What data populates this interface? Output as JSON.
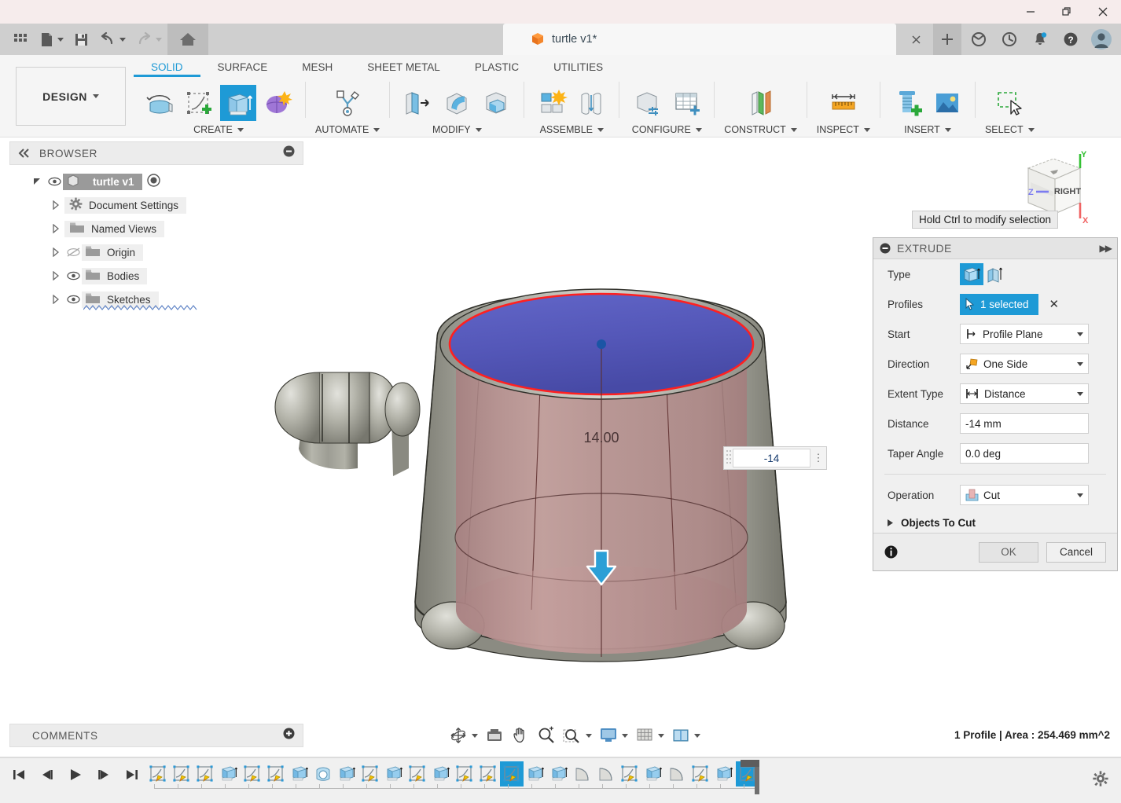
{
  "window": {
    "minimize_icon": "minimize-icon",
    "maximize_icon": "maximize-restore-icon",
    "close_icon": "close-icon"
  },
  "quick_access": {
    "items": [
      {
        "name": "app-grid-icon",
        "label": "Grid"
      },
      {
        "name": "file-icon",
        "label": "File"
      },
      {
        "name": "save-icon",
        "label": "Save"
      },
      {
        "name": "undo-icon",
        "label": "Undo"
      },
      {
        "name": "redo-icon",
        "label": "Redo"
      },
      {
        "name": "home-icon",
        "label": "Home"
      }
    ]
  },
  "document_tab": {
    "title": "turtle v1*",
    "close_label": "×",
    "new_tab_label": "+"
  },
  "tab_right_icons": [
    {
      "name": "extensions-icon"
    },
    {
      "name": "recent-icon"
    },
    {
      "name": "notifications-icon"
    },
    {
      "name": "help-icon"
    },
    {
      "name": "account-avatar"
    }
  ],
  "ribbon": {
    "design_label": "DESIGN",
    "workspace_tabs": [
      {
        "label": "SOLID",
        "active": true
      },
      {
        "label": "SURFACE",
        "active": false
      },
      {
        "label": "MESH",
        "active": false
      },
      {
        "label": "SHEET METAL",
        "active": false
      },
      {
        "label": "PLASTIC",
        "active": false
      },
      {
        "label": "UTILITIES",
        "active": false
      }
    ],
    "groups": [
      {
        "label": "CREATE",
        "icons": [
          "revolve-icon",
          "create-sketch-icon",
          "extrude-icon",
          "form-icon"
        ]
      },
      {
        "label": "AUTOMATE",
        "icons": [
          "automate-icon"
        ]
      },
      {
        "label": "MODIFY",
        "icons": [
          "press-pull-icon",
          "fillet-icon",
          "shell-icon"
        ]
      },
      {
        "label": "ASSEMBLE",
        "icons": [
          "new-component-icon",
          "joint-icon"
        ]
      },
      {
        "label": "CONFIGURE",
        "icons": [
          "configure-icon",
          "configure-table-icon"
        ]
      },
      {
        "label": "CONSTRUCT",
        "icons": [
          "offset-plane-icon"
        ]
      },
      {
        "label": "INSPECT",
        "icons": [
          "measure-icon"
        ]
      },
      {
        "label": "INSERT",
        "icons": [
          "insert-mcmaster-icon",
          "insert-canvas-icon"
        ]
      },
      {
        "label": "SELECT",
        "icons": [
          "select-icon"
        ]
      }
    ]
  },
  "browser": {
    "header": "BROWSER",
    "collapse_icon": "collapse-icon",
    "tree": [
      {
        "label": "turtle v1",
        "indent": 0,
        "expanded": true,
        "eye": "visible",
        "icon": "component-icon",
        "root": true
      },
      {
        "label": "Document Settings",
        "indent": 1,
        "expanded": false,
        "eye": "none",
        "icon": "gear-icon",
        "root": false
      },
      {
        "label": "Named Views",
        "indent": 1,
        "expanded": false,
        "eye": "none",
        "icon": "folder-icon",
        "root": false
      },
      {
        "label": "Origin",
        "indent": 1,
        "expanded": false,
        "eye": "hidden",
        "icon": "folder-icon",
        "root": false
      },
      {
        "label": "Bodies",
        "indent": 1,
        "expanded": false,
        "eye": "visible",
        "icon": "folder-icon",
        "root": false
      },
      {
        "label": "Sketches",
        "indent": 1,
        "expanded": false,
        "eye": "visible",
        "icon": "sketch-folder-icon",
        "root": false
      }
    ]
  },
  "canvas": {
    "dimension_label": "14.00",
    "tooltip": "Hold Ctrl to modify selection",
    "mini_input_value": "-14",
    "viewcube_faces": {
      "front": "RIGHT"
    },
    "axis_labels": {
      "x": "X",
      "y": "Y",
      "z": "Z"
    },
    "colors": {
      "profile_face": "#5457b8",
      "preview_cut": "#b98b8b",
      "highlight_edge": "#ff2020",
      "body": "#9a9a92",
      "arrow": "#2c9fd6"
    }
  },
  "extrude_dialog": {
    "title": "EXTRUDE",
    "collapse_icon": "collapse-icon",
    "expand_icon": "expand-icon",
    "rows": {
      "type_label": "Type",
      "type_options": [
        "solid-extrude-icon",
        "thin-extrude-icon"
      ],
      "profiles_label": "Profiles",
      "profiles_value": "1 selected",
      "profiles_clear": "✕",
      "start_label": "Start",
      "start_value": "Profile Plane",
      "direction_label": "Direction",
      "direction_value": "One Side",
      "extent_label": "Extent Type",
      "extent_value": "Distance",
      "distance_label": "Distance",
      "distance_value": "-14 mm",
      "taper_label": "Taper Angle",
      "taper_value": "0.0 deg",
      "operation_label": "Operation",
      "operation_value": "Cut",
      "objects_label": "Objects To Cut"
    },
    "footer": {
      "info_icon": "info-icon",
      "ok_label": "OK",
      "cancel_label": "Cancel"
    }
  },
  "comments": {
    "header": "COMMENTS",
    "add_icon": "add-comment-icon"
  },
  "nav_bar": {
    "items": [
      {
        "name": "orbit-icon",
        "has_dropdown": true
      },
      {
        "name": "look-at-icon",
        "has_dropdown": false
      },
      {
        "name": "pan-icon",
        "has_dropdown": false
      },
      {
        "name": "zoom-icon",
        "has_dropdown": false
      },
      {
        "name": "fit-icon",
        "has_dropdown": true
      },
      {
        "name": "display-settings-icon",
        "has_dropdown": true
      },
      {
        "name": "grid-snaps-icon",
        "has_dropdown": true
      },
      {
        "name": "viewports-icon",
        "has_dropdown": true
      }
    ]
  },
  "status": {
    "text": "1 Profile | Area : 254.469 mm^2"
  },
  "timeline": {
    "playback": [
      "skip-start-icon",
      "step-back-icon",
      "play-icon",
      "step-forward-icon",
      "skip-end-icon"
    ],
    "features": [
      {
        "type": "sketch",
        "selected": false
      },
      {
        "type": "sketch",
        "selected": false
      },
      {
        "type": "sketch",
        "selected": false
      },
      {
        "type": "extrude",
        "selected": false
      },
      {
        "type": "sketch",
        "selected": false
      },
      {
        "type": "sketch",
        "selected": false
      },
      {
        "type": "extrude",
        "selected": false
      },
      {
        "type": "revolve",
        "selected": false
      },
      {
        "type": "extrude",
        "selected": false
      },
      {
        "type": "sketch",
        "selected": false
      },
      {
        "type": "extrude",
        "selected": false
      },
      {
        "type": "sketch",
        "selected": false
      },
      {
        "type": "extrude",
        "selected": false
      },
      {
        "type": "sketch",
        "selected": false
      },
      {
        "type": "sketch",
        "selected": false
      },
      {
        "type": "sketch",
        "selected": true
      },
      {
        "type": "extrude",
        "selected": false
      },
      {
        "type": "extrude",
        "selected": false
      },
      {
        "type": "fillet",
        "selected": false
      },
      {
        "type": "fillet",
        "selected": false
      },
      {
        "type": "sketch",
        "selected": false
      },
      {
        "type": "extrude",
        "selected": false
      },
      {
        "type": "fillet",
        "selected": false
      },
      {
        "type": "sketch",
        "selected": false
      },
      {
        "type": "extrude",
        "selected": false
      },
      {
        "type": "sketch",
        "selected": true
      }
    ],
    "settings_icon": "gear-icon"
  }
}
